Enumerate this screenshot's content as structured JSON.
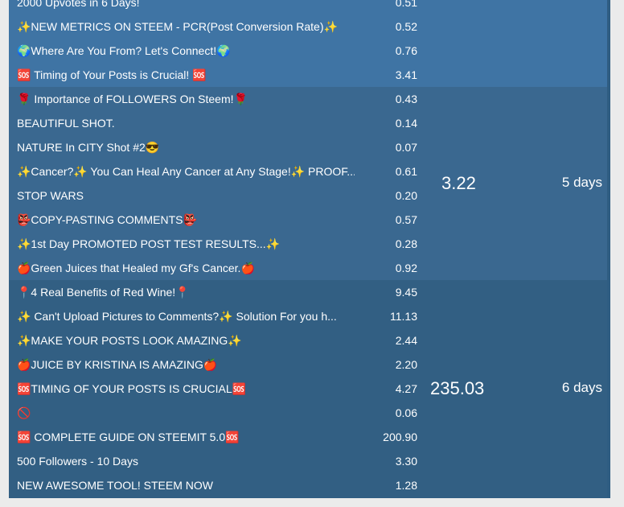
{
  "groups": [
    {
      "color": "#3f74a4",
      "summary": "",
      "days": "",
      "rows": [
        {
          "title": "2000 Upvotes in 6 Days!",
          "value": "0.51"
        },
        {
          "title": "✨NEW METRICS ON STEEM - PCR(Post Conversion Rate)✨",
          "value": "0.52"
        },
        {
          "title": "🌍Where Are You From? Let's Connect!🌍",
          "value": "0.76"
        },
        {
          "title": "🆘 Timing of Your Posts is Crucial! 🆘",
          "value": "3.41"
        }
      ]
    },
    {
      "color": "#3a6890",
      "summary": "3.22",
      "days": "5 days",
      "rows": [
        {
          "title": "🌹 Importance of FOLLOWERS On Steem!🌹",
          "value": "0.43"
        },
        {
          "title": "BEAUTIFUL SHOT.",
          "value": "0.14"
        },
        {
          "title": "NATURE In CITY Shot #2😎",
          "value": "0.07"
        },
        {
          "title": "✨Cancer?✨ You Can Heal Any Cancer at Any Stage!✨ PROOF...",
          "value": "0.61"
        },
        {
          "title": "STOP WARS",
          "value": "0.20"
        },
        {
          "title": "👺COPY-PASTING COMMENTS👺",
          "value": "0.57"
        },
        {
          "title": "✨1st Day PROMOTED POST TEST RESULTS...✨",
          "value": "0.28"
        },
        {
          "title": "🍎Green Juices that Healed my Gf's Cancer.🍎",
          "value": "0.92"
        }
      ]
    },
    {
      "color": "#325f83",
      "summary": "235.03",
      "days": "6 days",
      "rows": [
        {
          "title": "📍4 Real Benefits of Red Wine!📍",
          "value": "9.45"
        },
        {
          "title": "✨ Can't Upload Pictures to Comments?✨ Solution For you h...",
          "value": "11.13"
        },
        {
          "title": "✨MAKE YOUR POSTS LOOK AMAZING✨",
          "value": "2.44"
        },
        {
          "title": "🍎JUICE BY KRISTINA IS AMAZING🍎",
          "value": "2.20"
        },
        {
          "title": "🆘TIMING OF YOUR POSTS IS CRUCIAL🆘",
          "value": "4.27"
        },
        {
          "title": "🚫",
          "value": "0.06"
        },
        {
          "title": "🆘 COMPLETE GUIDE ON STEEMIT 5.0🆘",
          "value": "200.90"
        },
        {
          "title": "500 Followers - 10 Days",
          "value": "3.30"
        },
        {
          "title": "NEW AWESOME TOOL! STEEM NOW",
          "value": "1.28"
        }
      ]
    }
  ]
}
